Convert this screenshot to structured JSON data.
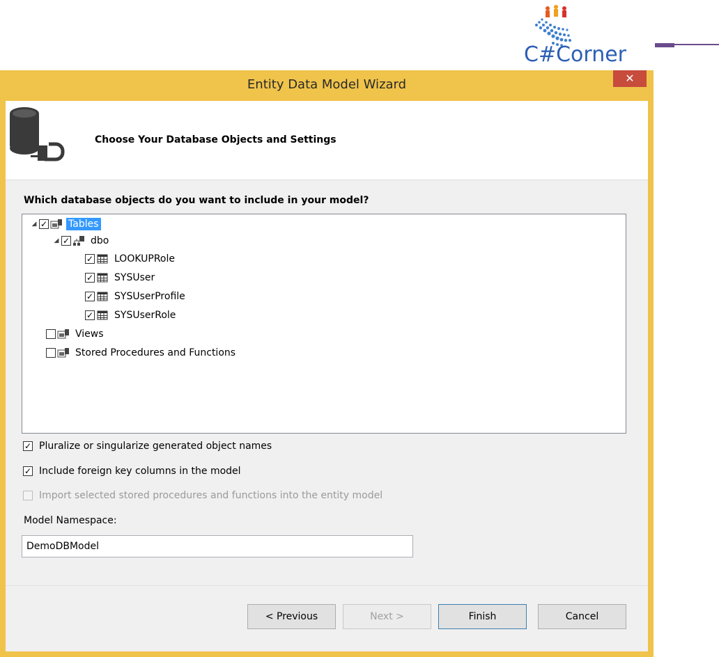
{
  "logo": {
    "text": "C#Corner"
  },
  "window": {
    "title": "Entity Data Model Wizard",
    "close_glyph": "✕"
  },
  "header": {
    "title": "Choose Your Database Objects and Settings",
    "icon": "database-connect-icon"
  },
  "question": "Which database objects do you want to include in your model?",
  "tree": {
    "tables": {
      "label": "Tables",
      "checked": true,
      "expanded": true,
      "selected": true
    },
    "schema": {
      "label": "dbo",
      "checked": true,
      "expanded": true
    },
    "table_items": [
      {
        "label": "LOOKUPRole",
        "checked": true
      },
      {
        "label": "SYSUser",
        "checked": true
      },
      {
        "label": "SYSUserProfile",
        "checked": true
      },
      {
        "label": "SYSUserRole",
        "checked": true
      }
    ],
    "views": {
      "label": "Views",
      "checked": false
    },
    "procedures": {
      "label": "Stored Procedures and Functions",
      "checked": false
    }
  },
  "options": {
    "pluralize": {
      "label": "Pluralize or singularize generated object names",
      "checked": true
    },
    "foreign_keys": {
      "label": "Include foreign key columns in the model",
      "checked": true
    },
    "import_procs": {
      "label": "Import selected stored procedures and functions into the entity model",
      "checked": false,
      "enabled": false
    }
  },
  "namespace": {
    "label": "Model Namespace:",
    "value": "DemoDBModel"
  },
  "buttons": {
    "previous": "< Previous",
    "next": "Next >",
    "finish": "Finish",
    "cancel": "Cancel"
  },
  "colors": {
    "window_frame": "#f0c34a",
    "close_button": "#c74c3c",
    "selection": "#3399ff",
    "logo_text": "#2b5fb3"
  }
}
